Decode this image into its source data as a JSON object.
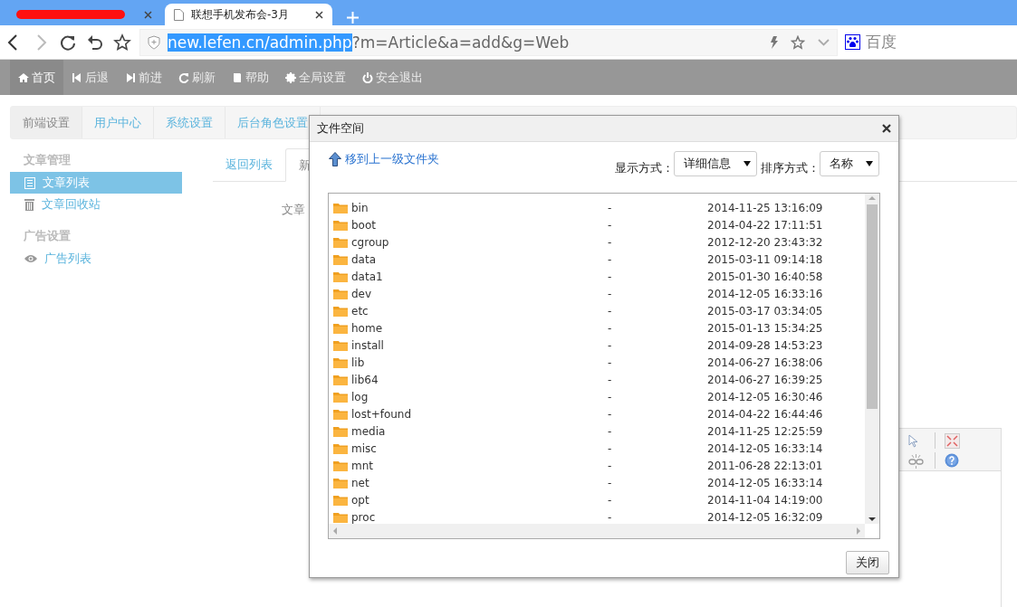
{
  "browser": {
    "tabs": [
      {
        "selected": false,
        "redacted": true
      },
      {
        "title": "联想手机发布会-3月",
        "selected": true,
        "redacted": false
      }
    ],
    "address": {
      "selected_part": "new.lefen.cn/admin.php",
      "rest": "?m=Article&a=add&g=Web"
    },
    "search_engine": "百度"
  },
  "toolbar": [
    {
      "label": "首页",
      "selected": true
    },
    {
      "label": "后退",
      "selected": false
    },
    {
      "label": "前进",
      "selected": false
    },
    {
      "label": "刷新",
      "selected": false
    },
    {
      "label": "帮助",
      "selected": false
    },
    {
      "label": "全局设置",
      "selected": false
    },
    {
      "label": "安全退出",
      "selected": false
    }
  ],
  "nav_tabs": [
    {
      "label": "前端设置",
      "selected": true
    },
    {
      "label": "用户中心",
      "selected": false
    },
    {
      "label": "系统设置",
      "selected": false
    },
    {
      "label": "后台角色设置",
      "selected": false
    }
  ],
  "sidebar": [
    {
      "title": "文章管理",
      "items": [
        {
          "label": "文章列表",
          "selected": true
        },
        {
          "label": "文章回收站",
          "selected": false
        }
      ]
    },
    {
      "title": "广告设置",
      "items": [
        {
          "label": "广告列表",
          "selected": false
        }
      ]
    }
  ],
  "content": {
    "tabs": [
      {
        "label": "返回列表",
        "selected": false
      },
      {
        "label": "新",
        "selected": true
      }
    ],
    "field_label": "文章"
  },
  "dialog": {
    "title": "文件空间",
    "up_link": "移到上一级文件夹",
    "view_label": "显示方式：",
    "view_value": "详细信息",
    "sort_label": "排序方式：",
    "sort_value": "名称",
    "close_button": "关闭",
    "files": [
      {
        "name": "bin",
        "size": "-",
        "modified": "2014-11-25 13:16:09"
      },
      {
        "name": "boot",
        "size": "-",
        "modified": "2014-04-22 17:11:51"
      },
      {
        "name": "cgroup",
        "size": "-",
        "modified": "2012-12-20 23:43:32"
      },
      {
        "name": "data",
        "size": "-",
        "modified": "2015-03-11 09:14:18"
      },
      {
        "name": "data1",
        "size": "-",
        "modified": "2015-01-30 16:40:58"
      },
      {
        "name": "dev",
        "size": "-",
        "modified": "2014-12-05 16:33:16"
      },
      {
        "name": "etc",
        "size": "-",
        "modified": "2015-03-17 03:34:05"
      },
      {
        "name": "home",
        "size": "-",
        "modified": "2015-01-13 15:34:25"
      },
      {
        "name": "install",
        "size": "-",
        "modified": "2014-09-28 14:53:23"
      },
      {
        "name": "lib",
        "size": "-",
        "modified": "2014-06-27 16:38:06"
      },
      {
        "name": "lib64",
        "size": "-",
        "modified": "2014-06-27 16:39:25"
      },
      {
        "name": "log",
        "size": "-",
        "modified": "2014-12-05 16:30:46"
      },
      {
        "name": "lost+found",
        "size": "-",
        "modified": "2014-04-22 16:44:46"
      },
      {
        "name": "media",
        "size": "-",
        "modified": "2014-11-25 12:25:59"
      },
      {
        "name": "misc",
        "size": "-",
        "modified": "2014-12-05 16:33:14"
      },
      {
        "name": "mnt",
        "size": "-",
        "modified": "2011-06-28 22:13:01"
      },
      {
        "name": "net",
        "size": "-",
        "modified": "2014-12-05 16:33:14"
      },
      {
        "name": "opt",
        "size": "-",
        "modified": "2014-11-04 14:19:00"
      },
      {
        "name": "proc",
        "size": "-",
        "modified": "2014-12-05 16:32:09"
      }
    ]
  }
}
